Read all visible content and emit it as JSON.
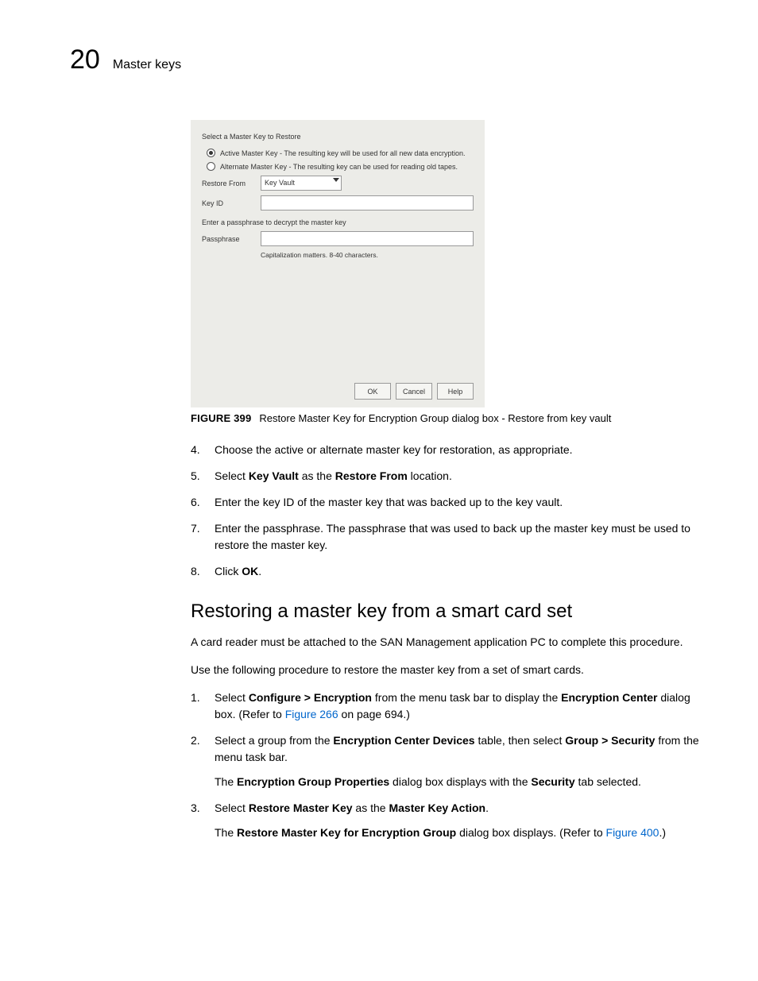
{
  "header": {
    "chapter_number": "20",
    "section_title": "Master keys"
  },
  "dialog": {
    "title": "Select a Master Key to Restore",
    "radio1": "Active Master Key - The resulting key will be used for all new data encryption.",
    "radio2": "Alternate Master Key - The resulting key can be used for reading old tapes.",
    "restore_from_label": "Restore From",
    "restore_from_value": "Key Vault",
    "key_id_label": "Key ID",
    "pass_intro": "Enter a passphrase to decrypt the master key",
    "pass_label": "Passphrase",
    "pass_hint": "Capitalization matters. 8-40 characters.",
    "btn_ok": "OK",
    "btn_cancel": "Cancel",
    "btn_help": "Help"
  },
  "figure": {
    "label": "FIGURE 399",
    "caption": "Restore Master Key for Encryption Group dialog box - Restore from key vault"
  },
  "steps_a": {
    "s4": {
      "num": "4.",
      "text": "Choose the active or alternate master key for restoration, as appropriate."
    },
    "s5": {
      "num": "5.",
      "pre": "Select ",
      "b1": "Key Vault",
      "mid": " as the ",
      "b2": "Restore From",
      "post": " location."
    },
    "s6": {
      "num": "6.",
      "text": "Enter the key ID of the master key that was backed up to the key vault."
    },
    "s7": {
      "num": "7.",
      "text": "Enter the passphrase. The passphrase that was used to back up the master key must be used to restore the master key."
    },
    "s8": {
      "num": "8.",
      "pre": "Click ",
      "b1": "OK",
      "post": "."
    }
  },
  "section2": {
    "heading": "Restoring a master key from a smart card set",
    "p1": "A card reader must be attached to the SAN Management application PC to complete this procedure.",
    "p2": "Use the following procedure to restore the master key from a set of smart cards."
  },
  "steps_b": {
    "s1": {
      "num": "1.",
      "pre": "Select ",
      "b1": "Configure > Encryption",
      "mid": " from the menu task bar to display the ",
      "b2": "Encryption Center",
      "post1": " dialog box. (Refer to ",
      "link": "Figure 266",
      "post2": " on page 694.)"
    },
    "s2": {
      "num": "2.",
      "pre": "Select a group from the ",
      "b1": "Encryption Center Devices",
      "mid": " table, then select ",
      "b2": "Group > Security",
      "post": " from the menu task bar.",
      "sub_pre": "The ",
      "sub_b1": "Encryption Group Properties",
      "sub_mid": " dialog box displays with the ",
      "sub_b2": "Security",
      "sub_post": " tab selected."
    },
    "s3": {
      "num": "3.",
      "pre": "Select ",
      "b1": "Restore Master Key",
      "mid": " as the ",
      "b2": "Master Key Action",
      "post": ".",
      "sub_pre": "The ",
      "sub_b1": "Restore Master Key for Encryption Group",
      "sub_mid": " dialog box displays. (Refer to ",
      "sub_link": "Figure 400",
      "sub_post": ".)"
    }
  }
}
